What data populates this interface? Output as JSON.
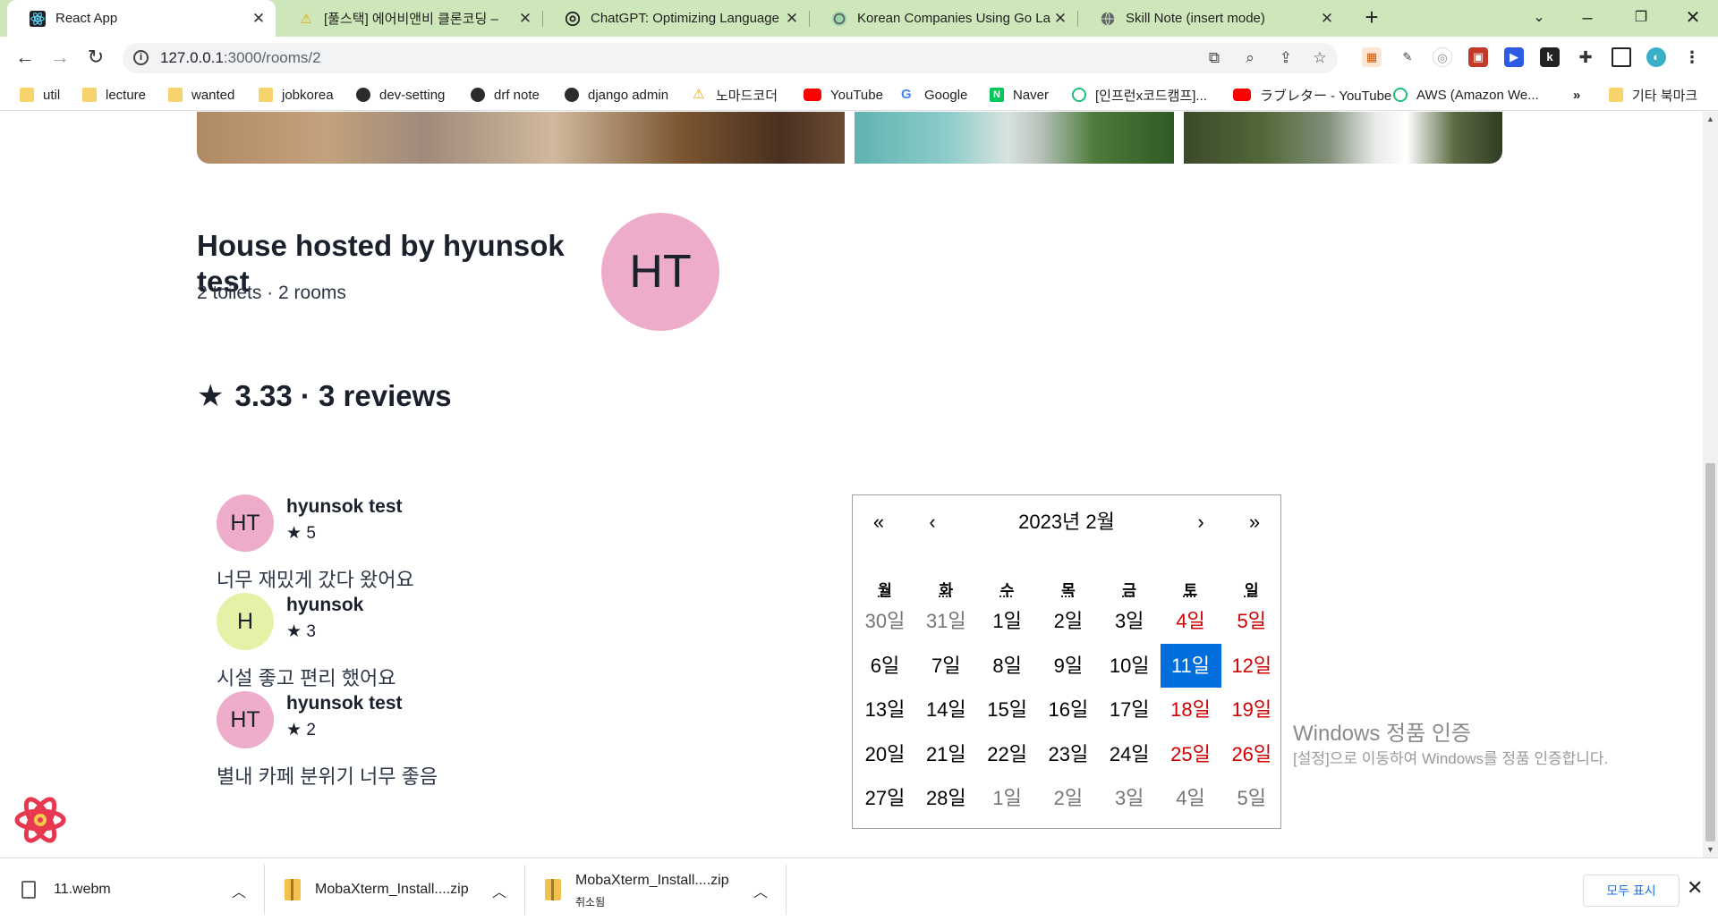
{
  "browser": {
    "tabs": [
      {
        "label": "React App",
        "icon": "react-icon",
        "active": true
      },
      {
        "label": "[풀스택] 에어비앤비 클론코딩 –",
        "icon": "warning-icon",
        "active": false
      },
      {
        "label": "ChatGPT: Optimizing Language",
        "icon": "chatgpt-icon",
        "active": false
      },
      {
        "label": "Korean Companies Using Go La",
        "icon": "chatgpt-icon",
        "active": false
      },
      {
        "label": "Skill Note (insert mode)",
        "icon": "globe-icon",
        "active": false
      }
    ],
    "url_host": "127.0.0.1",
    "url_path": ":3000/rooms/2",
    "bookmarks": [
      {
        "label": "util",
        "icon": "folder"
      },
      {
        "label": "lecture",
        "icon": "folder"
      },
      {
        "label": "wanted",
        "icon": "folder"
      },
      {
        "label": "jobkorea",
        "icon": "folder"
      },
      {
        "label": "dev-setting",
        "icon": "globe"
      },
      {
        "label": "drf note",
        "icon": "globe"
      },
      {
        "label": "django admin",
        "icon": "globe"
      },
      {
        "label": "노마드코더",
        "icon": "warning"
      },
      {
        "label": "YouTube",
        "icon": "youtube"
      },
      {
        "label": "Google",
        "icon": "google"
      },
      {
        "label": "Naver",
        "icon": "naver"
      },
      {
        "label": "[인프런x코드캠프]...",
        "icon": "inflearn"
      },
      {
        "label": "ラブレター - YouTube",
        "icon": "youtube"
      },
      {
        "label": "AWS (Amazon We...",
        "icon": "inflearn"
      }
    ],
    "bookmarks_more": "»",
    "other_bookmarks": "기타 북마크"
  },
  "page": {
    "host_title": "House hosted by hyunsok test",
    "host_sub": "2 toilets · 2 rooms",
    "host_avatar_initials": "HT",
    "rating_summary": "3.33 · 3 reviews",
    "reviews": [
      {
        "initials": "HT",
        "name": "hyunsok test",
        "rating": "5",
        "text": "너무 재밌게 갔다 왔어요",
        "avatar_color": "#eeaccb"
      },
      {
        "initials": "H",
        "name": "hyunsok",
        "rating": "3",
        "text": "시설 좋고 편리 했어요",
        "avatar_color": "#e6f1a8"
      },
      {
        "initials": "HT",
        "name": "hyunsok test",
        "rating": "2",
        "text": "별내 카페 분위기 너무 좋음",
        "avatar_color": "#eeaccb"
      }
    ]
  },
  "calendar": {
    "prev2": "«",
    "prev": "‹",
    "label": "2023년 2월",
    "next": "›",
    "next2": "»",
    "weekdays": [
      "월",
      "화",
      "수",
      "목",
      "금",
      "토",
      "일"
    ],
    "weeks": [
      [
        {
          "d": "30일",
          "t": "other"
        },
        {
          "d": "31일",
          "t": "other"
        },
        {
          "d": "1일",
          "t": ""
        },
        {
          "d": "2일",
          "t": ""
        },
        {
          "d": "3일",
          "t": ""
        },
        {
          "d": "4일",
          "t": "weekend"
        },
        {
          "d": "5일",
          "t": "weekend"
        }
      ],
      [
        {
          "d": "6일",
          "t": ""
        },
        {
          "d": "7일",
          "t": ""
        },
        {
          "d": "8일",
          "t": ""
        },
        {
          "d": "9일",
          "t": ""
        },
        {
          "d": "10일",
          "t": ""
        },
        {
          "d": "11일",
          "t": "active"
        },
        {
          "d": "12일",
          "t": "weekend"
        }
      ],
      [
        {
          "d": "13일",
          "t": ""
        },
        {
          "d": "14일",
          "t": ""
        },
        {
          "d": "15일",
          "t": ""
        },
        {
          "d": "16일",
          "t": ""
        },
        {
          "d": "17일",
          "t": ""
        },
        {
          "d": "18일",
          "t": "weekend"
        },
        {
          "d": "19일",
          "t": "weekend"
        }
      ],
      [
        {
          "d": "20일",
          "t": ""
        },
        {
          "d": "21일",
          "t": ""
        },
        {
          "d": "22일",
          "t": ""
        },
        {
          "d": "23일",
          "t": ""
        },
        {
          "d": "24일",
          "t": ""
        },
        {
          "d": "25일",
          "t": "weekend"
        },
        {
          "d": "26일",
          "t": "weekend"
        }
      ],
      [
        {
          "d": "27일",
          "t": ""
        },
        {
          "d": "28일",
          "t": ""
        },
        {
          "d": "1일",
          "t": "other"
        },
        {
          "d": "2일",
          "t": "other"
        },
        {
          "d": "3일",
          "t": "other"
        },
        {
          "d": "4일",
          "t": "other"
        },
        {
          "d": "5일",
          "t": "other"
        }
      ]
    ]
  },
  "watermark": {
    "line1": "Windows 정품 인증",
    "line2": "[설정]으로 이동하여 Windows를 정품 인증합니다."
  },
  "downloads": {
    "items": [
      {
        "name": "11.webm",
        "sub": ""
      },
      {
        "name": "MobaXterm_Install....zip",
        "sub": ""
      },
      {
        "name": "MobaXterm_Install....zip",
        "sub": "취소됨"
      }
    ],
    "show_all": "모두 표시"
  },
  "colors": {
    "tabstrip": "#cde7ba",
    "active_day": "#006edc",
    "weekend": "#d10000",
    "avatar_pink": "#eeaccb",
    "avatar_lime": "#e6f1a8"
  }
}
